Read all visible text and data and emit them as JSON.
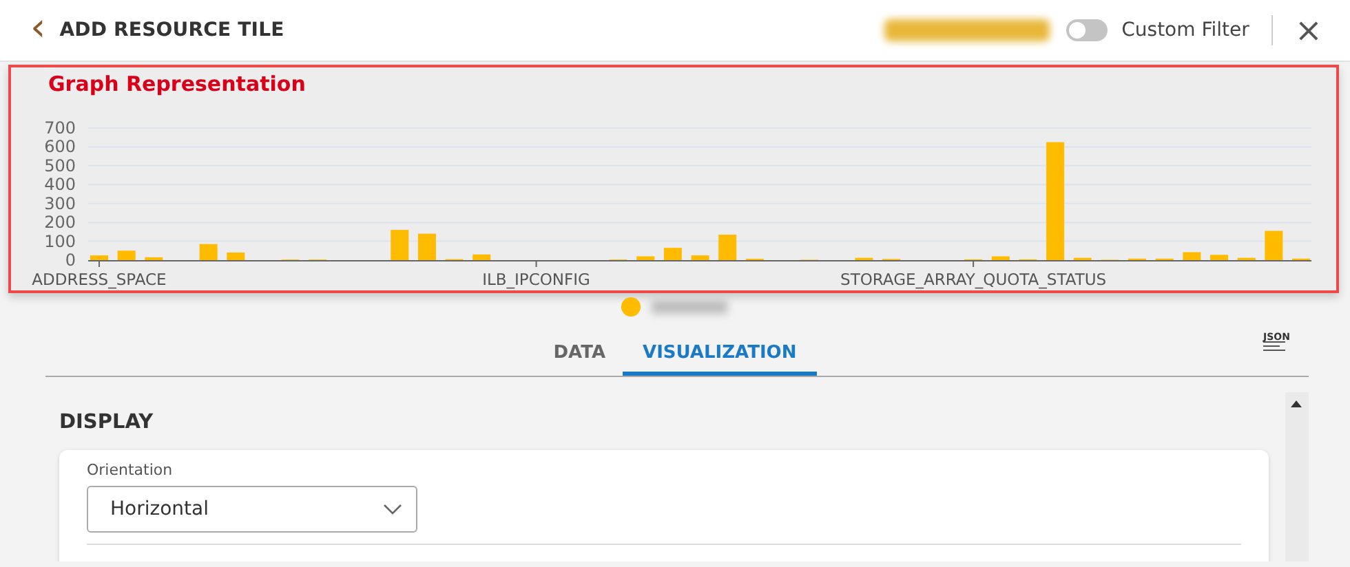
{
  "header": {
    "back_icon": "‹",
    "title": "ADD RESOURCE TILE",
    "toggle": {
      "label": "Custom Filter",
      "on": false
    },
    "close": "×"
  },
  "graph_panel": {
    "title": "Graph Representation",
    "chart_data": {
      "type": "bar",
      "grid": true,
      "ylim": [
        0,
        700
      ],
      "yticks": [
        0,
        100,
        200,
        300,
        400,
        500,
        600,
        700
      ],
      "categories": [
        "ADDRESS_SPACE",
        null,
        null,
        null,
        null,
        null,
        null,
        null,
        null,
        null,
        null,
        null,
        null,
        null,
        null,
        null,
        "ILB_IPCONFIG",
        null,
        null,
        null,
        null,
        null,
        null,
        null,
        null,
        null,
        null,
        null,
        null,
        null,
        null,
        null,
        "STORAGE_ARRAY_QUOTA_STATUS",
        null,
        null,
        null,
        null,
        null,
        null,
        null,
        null,
        null,
        null,
        null,
        null
      ],
      "series": [
        {
          "color": "#ffbb00",
          "values": [
            25,
            50,
            15,
            0,
            85,
            40,
            0,
            3,
            3,
            0,
            0,
            160,
            140,
            5,
            30,
            0,
            0,
            0,
            0,
            3,
            20,
            65,
            25,
            135,
            7,
            0,
            2,
            0,
            12,
            6,
            0,
            0,
            4,
            20,
            4,
            625,
            12,
            2,
            8,
            8,
            42,
            28,
            12,
            155,
            8
          ]
        }
      ]
    }
  },
  "tabs": [
    {
      "label": "DATA",
      "selected": false
    },
    {
      "label": "VISUALIZATION",
      "selected": true
    }
  ],
  "json_button": "JSON",
  "display": {
    "heading": "DISPLAY",
    "orientation": {
      "label": "Orientation",
      "value": "Horizontal"
    }
  }
}
